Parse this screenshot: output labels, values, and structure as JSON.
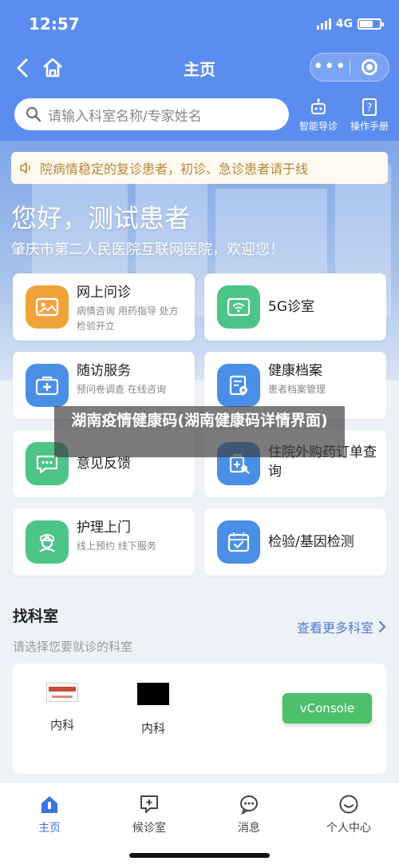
{
  "status": {
    "time": "12:57",
    "network": "4G"
  },
  "nav": {
    "title": "主页",
    "capsule_dots": "•••"
  },
  "search": {
    "placeholder": "请输入科室名称/专家姓名"
  },
  "tools": {
    "guide": "智能导诊",
    "manual": "操作手册"
  },
  "notice": {
    "text": "院病情稳定的复诊患者，初诊、急诊患者请于线"
  },
  "hero": {
    "greeting": "您好，测试患者",
    "welcome": "肇庆市第二人民医院互联网医院，欢迎您！"
  },
  "services": [
    {
      "title": "网上问诊",
      "sub": "病情咨询 用药指导 处方 检验开立",
      "icon": "image-card-icon",
      "color": "#f2a23a"
    },
    {
      "title": "5G诊室",
      "sub": "",
      "icon": "wifi-icon",
      "color": "#4cc586"
    },
    {
      "title": "随访服务",
      "sub": "预问卷调查 在线咨询",
      "icon": "medical-kit-icon",
      "color": "#4a8fe6"
    },
    {
      "title": "健康档案",
      "sub": "患者档案管理",
      "icon": "health-record-icon",
      "color": "#4a8fe6"
    },
    {
      "title": "意见反馈",
      "sub": "",
      "icon": "chat-bubble-icon",
      "color": "#4cc586"
    },
    {
      "title": "住院外购药订单查询",
      "sub": "",
      "icon": "medicine-search-icon",
      "color": "#4a8fe6"
    },
    {
      "title": "护理上门",
      "sub": "线上预约 线下服务",
      "icon": "nurse-icon",
      "color": "#4cc586"
    },
    {
      "title": "检验/基因检测",
      "sub": "",
      "icon": "calendar-check-icon",
      "color": "#4a8fe6"
    }
  ],
  "watermark": "湖南疫情健康码(湖南健康码详情界面)",
  "departments": {
    "title": "找科室",
    "more": "查看更多科室",
    "desc": "请选择您要就诊的科室",
    "items": [
      {
        "name": "内科"
      },
      {
        "name": "内科"
      }
    ]
  },
  "vconsole": "vConsole",
  "tabs": [
    {
      "label": "主页",
      "icon": "home-icon",
      "active": true
    },
    {
      "label": "候诊室",
      "icon": "waiting-room-icon",
      "active": false
    },
    {
      "label": "消息",
      "icon": "message-icon",
      "active": false
    },
    {
      "label": "个人中心",
      "icon": "profile-icon",
      "active": false
    }
  ],
  "colors": {
    "primary": "#5b8df0",
    "accent_blue": "#3a73e4",
    "green": "#4cc586",
    "orange": "#f2a23a",
    "vconsole_green": "#4cc06b"
  }
}
